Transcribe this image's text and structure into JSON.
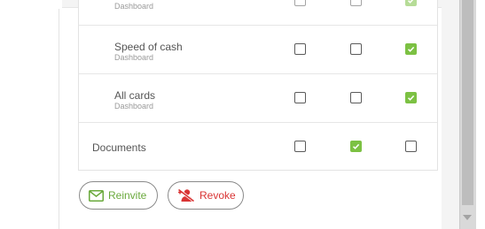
{
  "table": {
    "rows": [
      {
        "title": "",
        "subtitle": "Dashboard",
        "permissions": [
          false,
          false,
          true
        ]
      },
      {
        "title": "Speed of cash",
        "subtitle": "Dashboard",
        "permissions": [
          false,
          false,
          true
        ]
      },
      {
        "title": "All cards",
        "subtitle": "Dashboard",
        "permissions": [
          false,
          false,
          true
        ]
      },
      {
        "title": "Documents",
        "subtitle": "",
        "permissions": [
          false,
          true,
          false
        ]
      }
    ]
  },
  "actions": {
    "reinvite_label": "Reinvite",
    "revoke_label": "Revoke"
  },
  "colors": {
    "accent_green": "#7cc143",
    "danger_red": "#d93434"
  },
  "icons": {
    "reinvite": "envelope-icon",
    "revoke": "remove-user-icon"
  }
}
